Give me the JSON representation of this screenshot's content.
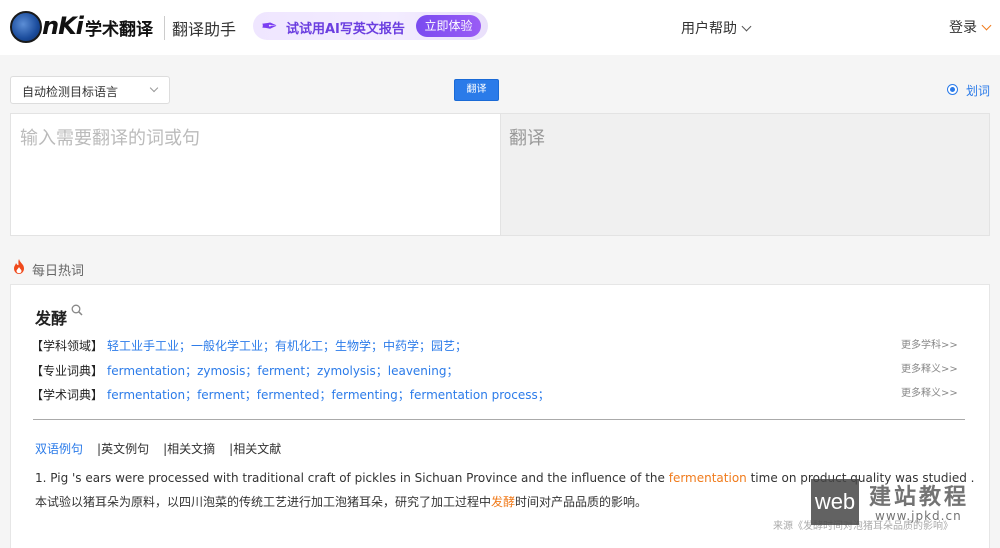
{
  "header": {
    "logo_text": "nKi",
    "brand": "学术翻译",
    "sub_brand": "翻译助手",
    "promo_text": "试试用AI写英文报告",
    "promo_button": "立即体验",
    "help_menu": "用户帮助",
    "login": "登录"
  },
  "toolbar": {
    "lang_select": "自动检测目标语言",
    "translate_button": "翻译",
    "word_select_label": "划词"
  },
  "panels": {
    "source_placeholder": "输入需要翻译的词或句",
    "target_placeholder": "翻译"
  },
  "hot_words": {
    "title": "每日热词",
    "word": "发酵",
    "rows": [
      {
        "label": "【学科领域】",
        "terms": "轻工业手工业；一般化学工业；有机化工；生物学；中药学；园艺；",
        "more": "更多学科>>"
      },
      {
        "label": "【专业词典】",
        "terms": "fermentation；zymosis；ferment；zymolysis；leavening；",
        "more": "更多释义>>"
      },
      {
        "label": "【学术词典】",
        "terms": "fermentation；ferment；fermented；fermenting；fermentation process；",
        "more": "更多释义>>"
      }
    ],
    "tabs": [
      "双语例句",
      "英文例句",
      "相关文摘",
      "相关文献"
    ],
    "separator": "|",
    "example": {
      "en_before": "1. Pig 's ears were processed with traditional craft of pickles in Sichuan Province and the influence of the ",
      "en_highlight": "fermentation",
      "en_after": " time on product quality was studied .",
      "cn_before": "本试验以猪耳朵为原料，以四川泡菜的传统工艺进行加工泡猪耳朵，研究了加工过程中",
      "cn_highlight": "发酵",
      "cn_after": "时间对产品品质的影响。",
      "source": "来源《发酵时间对泡猪耳朵品质的影响》"
    }
  },
  "watermark": {
    "box": "web",
    "cn": "建站教程",
    "url": "www.jpkd.cn"
  },
  "colors": {
    "accent": "#2b7be9",
    "highlight": "#f07b1c",
    "promo": "#7a4bf0"
  }
}
